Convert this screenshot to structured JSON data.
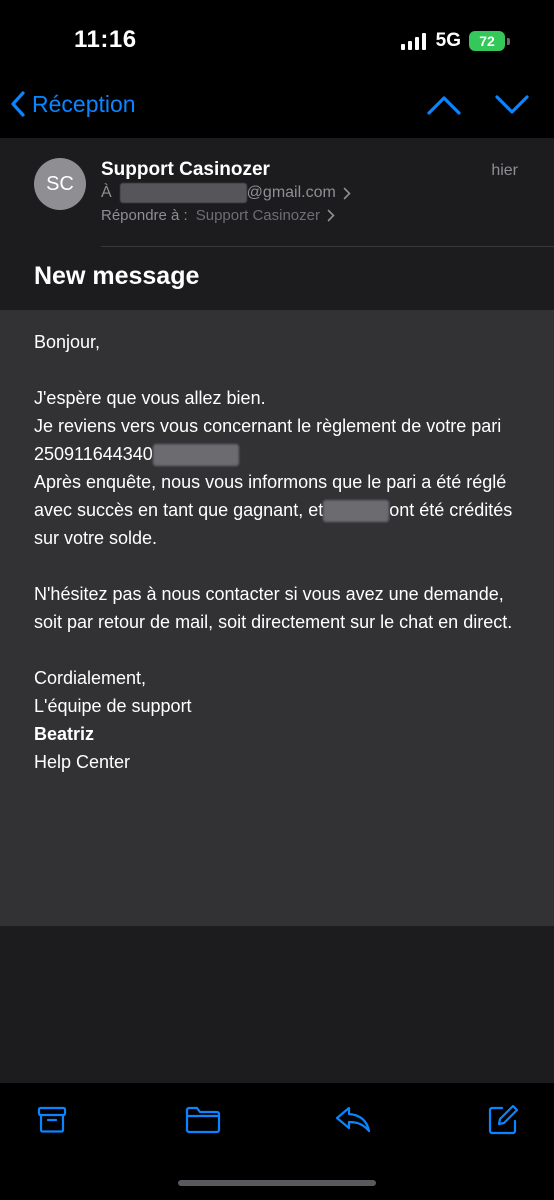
{
  "status_bar": {
    "time": "11:16",
    "network": "5G",
    "battery": "72"
  },
  "nav": {
    "back_label": "Réception",
    "accent_color": "#0a84ff"
  },
  "header": {
    "avatar_initials": "SC",
    "sender": "Support Casinozer",
    "date": "hier",
    "to_prefix": "À",
    "to_domain": "@gmail.com",
    "reply_prefix": "Répondre à :",
    "reply_name": "Support Casinozer",
    "subject": "New message"
  },
  "body": {
    "greeting": "Bonjour,",
    "line1": "J'espère que vous allez bien.",
    "line2": "Je reviens vers vous concernant le règlement de votre pari 250911644340",
    "line3a": "Après enquête, nous vous informons que le pari a été réglé avec succès en tant que gagnant, et",
    "line3b": "ont été crédités sur votre solde.",
    "line4": "N'hésitez pas à nous contacter si vous avez une demande, soit par retour de mail, soit directement sur le chat en direct.",
    "closing1": "Cordialement,",
    "closing2": "L'équipe de support",
    "signature_name": "Beatriz",
    "signature_title": "Help Center"
  },
  "toolbar": {
    "icons": [
      "archive-icon",
      "folder-icon",
      "reply-icon",
      "compose-icon"
    ]
  }
}
